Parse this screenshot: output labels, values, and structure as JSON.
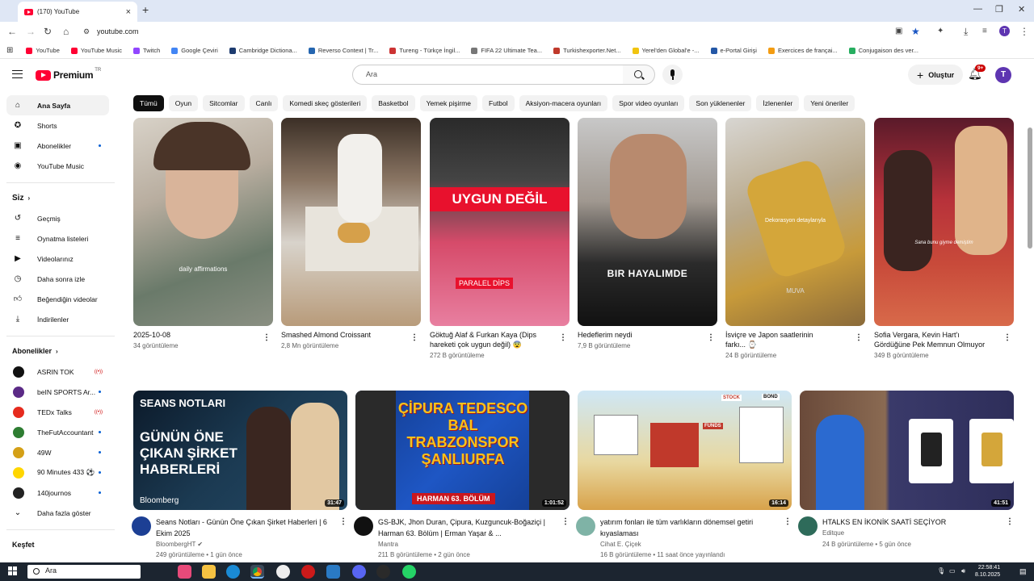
{
  "browser": {
    "tab_title": "(170) YouTube",
    "tab_close": "×",
    "new_tab": "+",
    "url": "youtube.com",
    "bookmarks": [
      {
        "label": "YouTube",
        "color": "#ff0033"
      },
      {
        "label": "YouTube Music",
        "color": "#ff0033"
      },
      {
        "label": "Twitch",
        "color": "#9146ff"
      },
      {
        "label": "Google Çeviri",
        "color": "#4285f4"
      },
      {
        "label": "Cambridge Dictiona...",
        "color": "#1d3b6f"
      },
      {
        "label": "Reverso Context | Tr...",
        "color": "#2566b0"
      },
      {
        "label": "Tureng - Türkçe İngil...",
        "color": "#cc3333"
      },
      {
        "label": "FIFA 22 Ultimate Tea...",
        "color": "#777777"
      },
      {
        "label": "Turkishexporter.Net...",
        "color": "#c0392b"
      },
      {
        "label": "Yerel'den Global'e -...",
        "color": "#f1c40f"
      },
      {
        "label": "e-Portal Girişi",
        "color": "#2457a6"
      },
      {
        "label": "Exercices de françai...",
        "color": "#f39c12"
      },
      {
        "label": "Conjugaison des ver...",
        "color": "#27ae60"
      }
    ]
  },
  "header": {
    "logo_text": "Premium",
    "logo_country": "TR",
    "search_placeholder": "Ara",
    "create_label": "Oluştur",
    "notification_count": "9+",
    "avatar_letter": "T"
  },
  "sidebar": {
    "main": [
      {
        "label": "Ana Sayfa",
        "icon": "home-icon",
        "active": true
      },
      {
        "label": "Shorts",
        "icon": "shorts-icon"
      },
      {
        "label": "Abonelikler",
        "icon": "subscriptions-icon",
        "dot": true
      },
      {
        "label": "YouTube Music",
        "icon": "music-icon"
      }
    ],
    "you_heading": "Siz",
    "you": [
      {
        "label": "Geçmiş",
        "icon": "history-icon"
      },
      {
        "label": "Oynatma listeleri",
        "icon": "playlists-icon"
      },
      {
        "label": "Videolarınız",
        "icon": "your-videos-icon"
      },
      {
        "label": "Daha sonra izle",
        "icon": "watch-later-icon"
      },
      {
        "label": "Beğendiğin videolar",
        "icon": "liked-icon"
      },
      {
        "label": "İndirilenler",
        "icon": "downloads-icon"
      }
    ],
    "subs_heading": "Abonelikler",
    "subs": [
      {
        "label": "ASRIN TOK",
        "color": "#111111",
        "live": true
      },
      {
        "label": "beIN SPORTS Ar...",
        "color": "#5b2a86",
        "dot": true
      },
      {
        "label": "TEDx Talks",
        "color": "#e62b1e",
        "live": true
      },
      {
        "label": "TheFutAccountant",
        "color": "#2e7d32",
        "dot": true
      },
      {
        "label": "49W",
        "color": "#d4a017",
        "dot": true
      },
      {
        "label": "90 Minutes 433 ⚽",
        "color": "#ffd600",
        "dot": true
      },
      {
        "label": "140journos",
        "color": "#222222",
        "dot": true
      }
    ],
    "show_more": "Daha fazla göster",
    "explore_heading": "Keşfet"
  },
  "chips": [
    "Tümü",
    "Oyun",
    "Sitcomlar",
    "Canlı",
    "Komedi skeç gösterileri",
    "Basketbol",
    "Yemek pişirme",
    "Futbol",
    "Aksiyon-macera oyunları",
    "Spor video oyunları",
    "Son yüklenenler",
    "İzlenenler",
    "Yeni öneriler"
  ],
  "shorts": [
    {
      "title": "2025-10-08",
      "title2": "",
      "views": "34 görüntüleme",
      "overlay": "daily affirmations"
    },
    {
      "title": "Smashed Almond Croissant",
      "title2": "",
      "views": "2,8 Mn görüntüleme",
      "overlay": ""
    },
    {
      "title": "Göktuğ Alaf & Furkan Kaya (Dips",
      "title2": "hareketi çok uygun değil) 😨",
      "views": "272 B görüntüleme",
      "overlay": "UYGUN DEĞİL",
      "overlay2": "PARALEL DİPS"
    },
    {
      "title": "Hedeflerim neydi",
      "title2": "",
      "views": "7,9 B görüntüleme",
      "overlay": "BIR HAYALIMDE"
    },
    {
      "title": "İsviçre ve Japon saatlerinin",
      "title2": "farkı... ⌚",
      "views": "24 B görüntüleme",
      "overlay": "Dekorasyon detaylarıyla",
      "overlay2": "MUVA"
    },
    {
      "title": "Sofia Vergara, Kevin Hart'ı",
      "title2": "Gördüğüne Pek Memnun Olmuyor",
      "views": "349 B görüntüleme",
      "overlay": "Sana bunu giyme demiştim"
    }
  ],
  "videos": [
    {
      "title": "Seans Notları - Günün Öne Çıkan Şirket Haberleri | 6 Ekim 2025",
      "channel": "BloombergHT ✔",
      "stats": "249 görüntüleme • 1 gün önce",
      "duration": "31:47",
      "thumb_top": "SEANS NOTLARI",
      "thumb_main": "GÜNÜN ÖNE ÇIKAN ŞİRKET HABERLERİ",
      "thumb_brand": "Bloomberg",
      "avatar_color": "#1c3f94"
    },
    {
      "title": "GS-BJK, Jhon Duran, Çipura, Kuzguncuk-Boğaziçi | Harman 63. Bölüm | Erman Yaşar & ...",
      "channel": "Mantra",
      "stats": "211 B görüntüleme • 2 gün önce",
      "duration": "1:01:52",
      "thumb_main": "ÇİPURA TEDESCO BAL TRABZONSPOR ŞANLIURFA",
      "thumb_banner": "HARMAN 63. BÖLÜM",
      "avatar_color": "#111111"
    },
    {
      "title": "yatırım fonları ile tüm varlıkların dönemsel getiri kıyaslaması",
      "channel": "Cihat E. Çiçek",
      "stats": "16 B görüntüleme • 11 saat önce yayınlandı",
      "duration": "16:14",
      "thumb_labels": [
        "STOCK",
        "BOND",
        "FUNDS"
      ],
      "avatar_color": "#7fb3a6"
    },
    {
      "title": "HTALKS EN İKONİK SAATİ SEÇİYOR",
      "channel": "Editque",
      "stats": "24 B görüntüleme • 5 gün önce",
      "duration": "41:51",
      "avatar_color": "#2e6b5a"
    }
  ],
  "taskbar": {
    "search_label": "Ara",
    "time": "22:58:41",
    "date": "8.10.2025"
  }
}
